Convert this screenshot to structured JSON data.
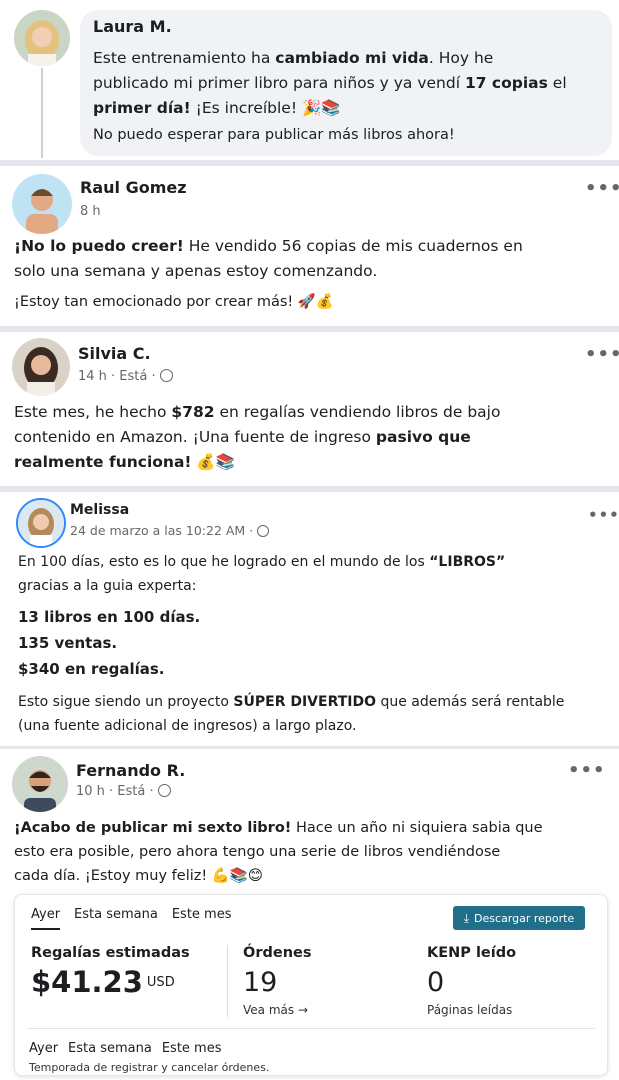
{
  "posts": [
    {
      "author": "Laura M.",
      "line1_pre": "Este entrenamiento ha ",
      "line1_bold": "cambiado mi vida",
      "line1_post": ". Hoy he",
      "line2_pre": "publicado mi primer libro para niños y ya vendí ",
      "line2_bold": "17 copias",
      "line2_post": " el",
      "line3_bold": "primer día!",
      "line3_post": " ¡Es increíble! 🎉📚",
      "line4": "No puedo esperar para publicar más libros ahora!"
    },
    {
      "author": "Raul Gomez",
      "time": "8 h",
      "line1_bold": "¡No lo puedo creer!",
      "line1_post": " He vendido 56 copias de mis cuadernos en",
      "line2": "solo una semana y apenas estoy comenzando.",
      "line3": "¡Estoy tan emocionado por crear más! 🚀💰"
    },
    {
      "author": "Silvia C.",
      "time": "14 h · Está ·",
      "line1_pre": "Este mes, he hecho ",
      "line1_bold": "$782",
      "line1_post": " en regalías vendiendo libros de bajo",
      "line2_pre": "contenido en Amazon. ¡Una fuente de ingreso ",
      "line2_bold": "pasivo que",
      "line3_bold": "realmente funciona!",
      "line3_post": " 💰📚"
    },
    {
      "author": "Melissa",
      "time": "24 de marzo a las 10:22 AM ·",
      "line1_pre": "En 100 días, esto es lo que he logrado en el mundo de los ",
      "line1_bold": "“LIBROS”",
      "line2": "gracias a la guia experta:",
      "stat1": "13 libros en 100 días.",
      "stat2": "135 ventas.",
      "stat3": "$340 en regalías.",
      "line3_pre": "Esto sigue siendo un proyecto ",
      "line3_bold": "SÚPER DIVERTIDO",
      "line3_post": " que además será rentable",
      "line4": "(una fuente adicional de ingresos) a largo plazo."
    },
    {
      "author": "Fernando R.",
      "time": "10 h · Está ·",
      "line1_bold": "¡Acabo de publicar mi sexto libro!",
      "line1_post": " Hace un año ni siquiera sabia que",
      "line2": "esto era posible, pero ahora tengo una serie de libros vendiéndose",
      "line3": "cada día. ¡Estoy muy feliz! 💪📚😊"
    }
  ],
  "more_label": "•••",
  "report": {
    "tabs": [
      "Ayer",
      "Esta semana",
      "Este mes"
    ],
    "download_label": "Descargar reporte",
    "royalties_label": "Regalías estimadas",
    "royalties_value": "$41.23",
    "royalties_unit": "USD",
    "orders_label": "Órdenes",
    "orders_value": "19",
    "orders_link": "Vea más →",
    "kenp_label": "KENP leído",
    "kenp_value": "0",
    "kenp_sub": "Páginas leídas",
    "bottom_tabs": [
      "Ayer",
      "Esta semana",
      "Este mes"
    ],
    "footer_note": "Temporada de registrar y cancelar órdenes."
  },
  "colors": {
    "button": "#1f6f8b",
    "bubble": "#f0f2f5",
    "meta": "#65676b"
  }
}
